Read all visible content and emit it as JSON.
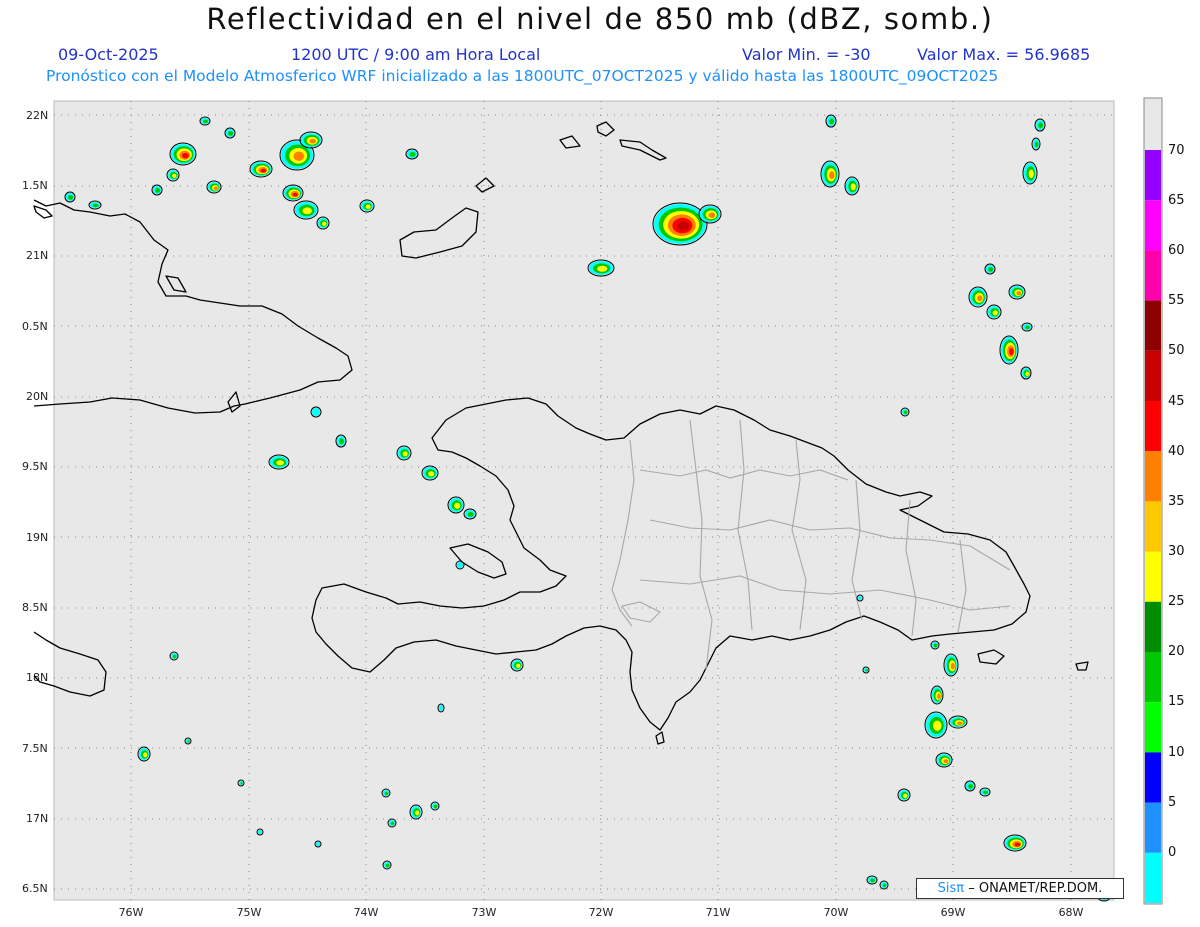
{
  "title": "Reflectividad en el nivel de 850 mb (dBZ, somb.)",
  "header": {
    "date": "09-Oct-2025",
    "time": "1200 UTC / 9:00 am Hora Local",
    "valmin": "Valor Min. = -30",
    "valmax": "Valor Max. = 56.9685",
    "subtitle": "Pronóstico con el Modelo Atmosferico WRF inicializado a las 1800UTC_07OCT2025 y válido hasta las  1800UTC_09OCT2025"
  },
  "axes": {
    "lat_labels": [
      "22N",
      "1.5N",
      "21N",
      "0.5N",
      "20N",
      "9.5N",
      "19N",
      "8.5N",
      "18N",
      "7.5N",
      "17N",
      "6.5N"
    ],
    "lon_labels": [
      "76W",
      "75W",
      "74W",
      "73W",
      "72W",
      "71W",
      "70W",
      "69W",
      "68W"
    ]
  },
  "colorbar": {
    "labels": [
      "70",
      "65",
      "60",
      "55",
      "50",
      "45",
      "40",
      "35",
      "30",
      "25",
      "20",
      "15",
      "10",
      "5",
      "0"
    ],
    "colors": [
      "#9400ff",
      "#ff00ff",
      "#ff00aa",
      "#8b0000",
      "#c80000",
      "#ff0000",
      "#ff7f00",
      "#ffc800",
      "#ffff00",
      "#008c00",
      "#00c800",
      "#00ff00",
      "#0000ff",
      "#1e90ff",
      "#00ffff"
    ]
  },
  "credit": {
    "sis": "Sisπ",
    "text": "– ONAMET/REP.DOM."
  },
  "colors": {
    "background": "#e8e8e8",
    "coast": "#000000",
    "provinces": "#a8a8a8",
    "grid": "#888888"
  }
}
